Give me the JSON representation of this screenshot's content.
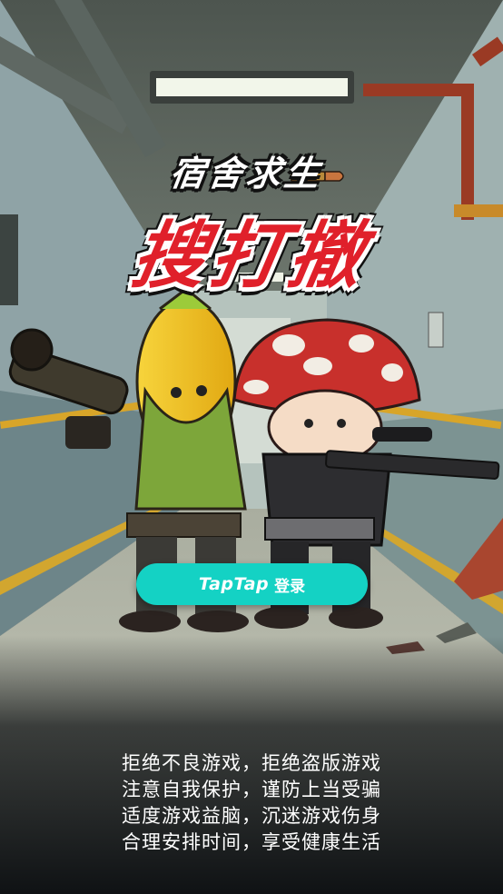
{
  "logo": {
    "subtitle": "宿舍求生",
    "title": "搜打撤"
  },
  "login": {
    "brand": "TapTap",
    "label": "登录"
  },
  "advisory": {
    "lines": [
      "拒绝不良游戏，拒绝盗版游戏",
      "注意自我保护，谨防上当受骗",
      "适度游戏益脑，沉迷游戏伤身",
      "合理安排时间，享受健康生活"
    ]
  },
  "colors": {
    "login_button": "#14d2c4",
    "logo_red": "#e0202a",
    "corridor_floor": "#b9bdb0",
    "mushroom_cap": "#c8302c",
    "corn": "#f3c31c"
  },
  "icons": {
    "bullet": "bullet-icon",
    "corn_character": "corn-soldier-illustration",
    "mushroom_character": "mushroom-soldier-illustration"
  }
}
